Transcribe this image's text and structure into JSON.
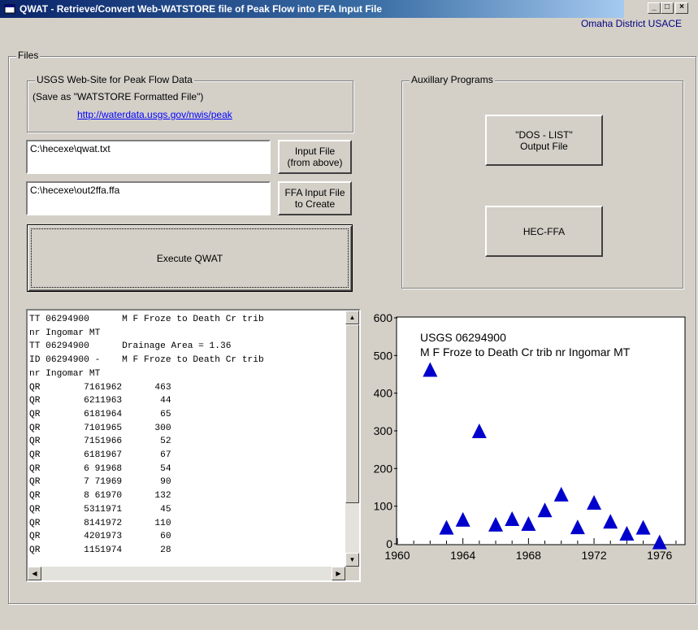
{
  "window": {
    "title": "QWAT - Retrieve/Convert Web-WATSTORE file of Peak Flow into FFA Input File",
    "controls": {
      "minimize": "_",
      "maximize": "□",
      "close": "×"
    },
    "district": "Omaha District USACE"
  },
  "files_group": {
    "label": "Files",
    "usgs_group": {
      "label": "USGS Web-Site for Peak Flow Data",
      "note": "(Save as \"WATSTORE Formatted File\")",
      "link": "http://waterdata.usgs.gov/nwis/peak"
    },
    "input_path": "C:\\hecexe\\qwat.txt",
    "input_button": {
      "line1": "Input File",
      "line2": "(from above)"
    },
    "output_path": "C:\\hecexe\\out2ffa.ffa",
    "output_button": {
      "line1": "FFA Input File",
      "line2": "to Create"
    },
    "execute_button": "Execute QWAT"
  },
  "aux_group": {
    "label": "Auxillary Programs",
    "dos_list_button": {
      "line1": "\"DOS - LIST\"",
      "line2": "Output File"
    },
    "hec_ffa_button": "HEC-FFA"
  },
  "listing": [
    "TT 06294900      M F Froze to Death Cr trib",
    "nr Ingomar MT",
    "TT 06294900      Drainage Area = 1.36",
    "ID 06294900 -    M F Froze to Death Cr trib",
    "nr Ingomar MT",
    "QR        7161962      463",
    "QR        6211963       44",
    "QR        6181964       65",
    "QR        7101965      300",
    "QR        7151966       52",
    "QR        6181967       67",
    "QR        6 91968       54",
    "QR        7 71969       90",
    "QR        8 61970      132",
    "QR        5311971       45",
    "QR        8141972      110",
    "QR        4201973       60",
    "QR        1151974       28"
  ],
  "chart_data": {
    "type": "scatter",
    "title": "USGS 06294900",
    "subtitle": "M F Froze to Death Cr trib nr Ingomar MT",
    "xlabel": "",
    "ylabel": "",
    "xlim": [
      1960,
      1977.5
    ],
    "ylim": [
      0,
      600
    ],
    "xticks": [
      1960,
      1964,
      1968,
      1972,
      1976
    ],
    "yticks": [
      0,
      100,
      200,
      300,
      400,
      500,
      600
    ],
    "marker": "triangle",
    "marker_color": "#0000cc",
    "points": [
      {
        "x": 1962,
        "y": 463
      },
      {
        "x": 1963,
        "y": 44
      },
      {
        "x": 1964,
        "y": 65
      },
      {
        "x": 1965,
        "y": 300
      },
      {
        "x": 1966,
        "y": 52
      },
      {
        "x": 1967,
        "y": 67
      },
      {
        "x": 1968,
        "y": 54
      },
      {
        "x": 1969,
        "y": 90
      },
      {
        "x": 1970,
        "y": 132
      },
      {
        "x": 1971,
        "y": 45
      },
      {
        "x": 1972,
        "y": 110
      },
      {
        "x": 1973,
        "y": 60
      },
      {
        "x": 1974,
        "y": 28
      },
      {
        "x": 1975,
        "y": 44
      },
      {
        "x": 1976,
        "y": 5
      }
    ]
  }
}
